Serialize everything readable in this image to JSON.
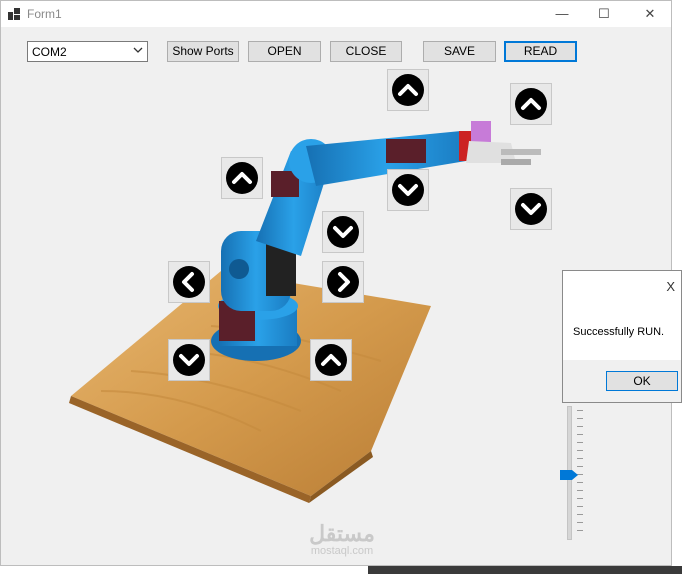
{
  "window": {
    "title": "Form1",
    "minimize": "—",
    "maximize": "☐",
    "close": "✕"
  },
  "toolbar": {
    "port_value": "COM2",
    "show_ports": "Show Ports",
    "open": "OPEN",
    "close": "CLOSE",
    "save": "SAVE",
    "read": "READ"
  },
  "controls": [
    {
      "name": "up",
      "icon": "chevron-up-icon"
    },
    {
      "name": "up",
      "icon": "chevron-up-icon"
    },
    {
      "name": "up",
      "icon": "chevron-up-icon"
    },
    {
      "name": "down",
      "icon": "chevron-down-icon"
    },
    {
      "name": "down",
      "icon": "chevron-down-icon"
    },
    {
      "name": "down",
      "icon": "chevron-down-icon"
    },
    {
      "name": "left",
      "icon": "chevron-left-icon"
    },
    {
      "name": "right",
      "icon": "chevron-right-icon"
    },
    {
      "name": "down",
      "icon": "chevron-down-icon"
    },
    {
      "name": "up",
      "icon": "chevron-up-icon"
    }
  ],
  "dialog": {
    "message": "Successfully RUN.",
    "ok": "OK",
    "close": "X"
  },
  "slider": {
    "value_fraction": 0.5
  },
  "watermark": {
    "arabic": "مستقل",
    "latin": "mostaql.com"
  },
  "colors": {
    "accent": "#0078d7",
    "arm": "#1f8fd6",
    "wood": "#d49a4c"
  }
}
